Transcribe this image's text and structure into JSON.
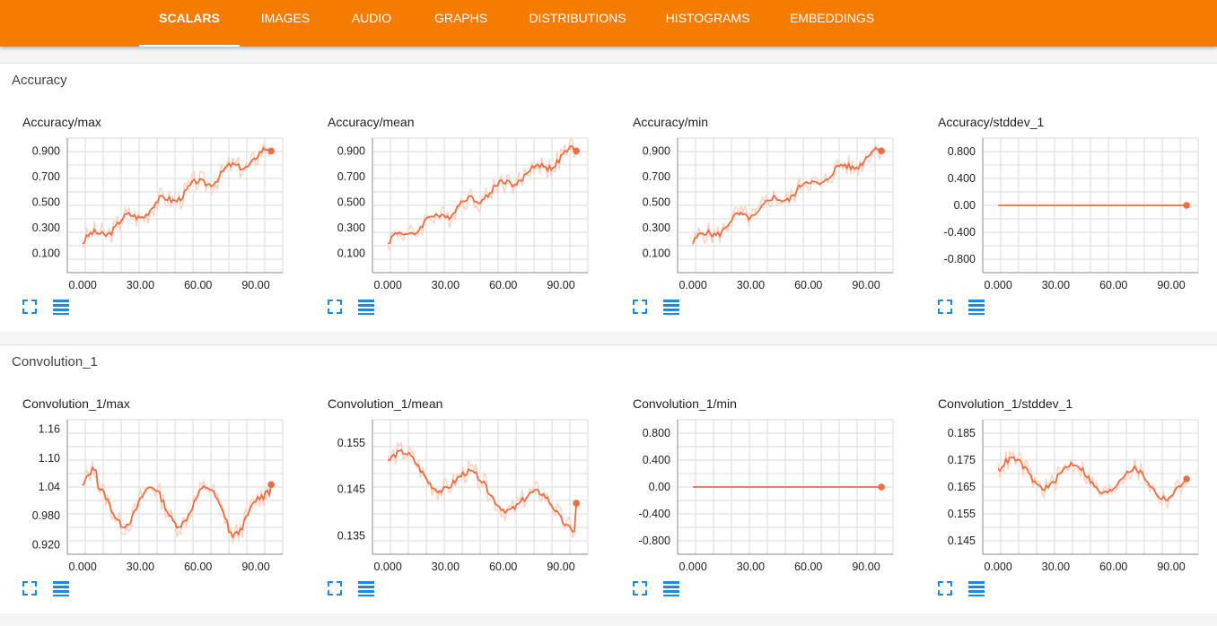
{
  "tabs": [
    {
      "label": "SCALARS",
      "active": true
    },
    {
      "label": "IMAGES",
      "active": false
    },
    {
      "label": "AUDIO",
      "active": false
    },
    {
      "label": "GRAPHS",
      "active": false
    },
    {
      "label": "DISTRIBUTIONS",
      "active": false
    },
    {
      "label": "HISTOGRAMS",
      "active": false
    },
    {
      "label": "EMBEDDINGS",
      "active": false
    }
  ],
  "colors": {
    "accent": "#f57c00",
    "line": "#ef6c3e",
    "line_raw": "#fbd3c4",
    "icon": "#1e88e5",
    "grid": "#d8d8d8"
  },
  "icons": {
    "expand": "fullscreen-icon",
    "data": "list-icon"
  },
  "sections": [
    {
      "name": "Accuracy",
      "charts": [
        {
          "title": "Accuracy/max",
          "yticks": [
            "0.900",
            "0.700",
            "0.500",
            "0.300",
            "0.100"
          ],
          "yvals": [
            0.9,
            0.7,
            0.5,
            0.3,
            0.1
          ],
          "ylim": [
            -0.05,
            1.0
          ],
          "xticks": [
            "0.000",
            "30.00",
            "60.00",
            "90.00"
          ],
          "xvals": [
            0,
            30,
            60,
            90
          ],
          "xlim": [
            -8,
            104
          ],
          "pattern": "rise",
          "start": 0.18,
          "end": 0.9
        },
        {
          "title": "Accuracy/mean",
          "yticks": [
            "0.900",
            "0.700",
            "0.500",
            "0.300",
            "0.100"
          ],
          "yvals": [
            0.9,
            0.7,
            0.5,
            0.3,
            0.1
          ],
          "ylim": [
            -0.05,
            1.0
          ],
          "xticks": [
            "0.000",
            "30.00",
            "60.00",
            "90.00"
          ],
          "xvals": [
            0,
            30,
            60,
            90
          ],
          "xlim": [
            -8,
            104
          ],
          "pattern": "rise",
          "start": 0.18,
          "end": 0.9
        },
        {
          "title": "Accuracy/min",
          "yticks": [
            "0.900",
            "0.700",
            "0.500",
            "0.300",
            "0.100"
          ],
          "yvals": [
            0.9,
            0.7,
            0.5,
            0.3,
            0.1
          ],
          "ylim": [
            -0.05,
            1.0
          ],
          "xticks": [
            "0.000",
            "30.00",
            "60.00",
            "90.00"
          ],
          "xvals": [
            0,
            30,
            60,
            90
          ],
          "xlim": [
            -8,
            104
          ],
          "pattern": "rise",
          "start": 0.18,
          "end": 0.9
        },
        {
          "title": "Accuracy/stddev_1",
          "yticks": [
            "0.800",
            "0.400",
            "0.00",
            "-0.400",
            "-0.800"
          ],
          "yvals": [
            0.8,
            0.4,
            0,
            -0.4,
            -0.8
          ],
          "ylim": [
            -1.0,
            1.0
          ],
          "xticks": [
            "0.000",
            "30.00",
            "60.00",
            "90.00"
          ],
          "xvals": [
            0,
            30,
            60,
            90
          ],
          "xlim": [
            -8,
            104
          ],
          "pattern": "flat",
          "start": 0,
          "end": 0
        }
      ]
    },
    {
      "name": "Convolution_1",
      "charts": [
        {
          "title": "Convolution_1/max",
          "yticks": [
            "1.16",
            "1.10",
            "1.04",
            "0.980",
            "0.920"
          ],
          "yvals": [
            1.16,
            1.1,
            1.04,
            0.98,
            0.92
          ],
          "ylim": [
            0.9,
            1.18
          ],
          "xticks": [
            "0.000",
            "30.00",
            "60.00",
            "90.00"
          ],
          "xvals": [
            0,
            30,
            60,
            90
          ],
          "xlim": [
            -8,
            104
          ],
          "pattern": "conv_max",
          "start": 1.02,
          "end": 1.045
        },
        {
          "title": "Convolution_1/mean",
          "yticks": [
            "0.155",
            "0.145",
            "0.135"
          ],
          "yvals": [
            0.155,
            0.145,
            0.135
          ],
          "ylim": [
            0.131,
            0.16
          ],
          "xticks": [
            "0.000",
            "30.00",
            "60.00",
            "90.00"
          ],
          "xvals": [
            0,
            30,
            60,
            90
          ],
          "xlim": [
            -8,
            104
          ],
          "pattern": "conv_mean",
          "start": 0.149,
          "end": 0.142
        },
        {
          "title": "Convolution_1/min",
          "yticks": [
            "0.800",
            "0.400",
            "0.00",
            "-0.400",
            "-0.800"
          ],
          "yvals": [
            0.8,
            0.4,
            0,
            -0.4,
            -0.8
          ],
          "ylim": [
            -1.0,
            1.0
          ],
          "xticks": [
            "0.000",
            "30.00",
            "60.00",
            "90.00"
          ],
          "xvals": [
            0,
            30,
            60,
            90
          ],
          "xlim": [
            -8,
            104
          ],
          "pattern": "flat",
          "start": 0,
          "end": 0
        },
        {
          "title": "Convolution_1/stddev_1",
          "yticks": [
            "0.185",
            "0.175",
            "0.165",
            "0.155",
            "0.145"
          ],
          "yvals": [
            0.185,
            0.175,
            0.165,
            0.155,
            0.145
          ],
          "ylim": [
            0.14,
            0.19
          ],
          "xticks": [
            "0.000",
            "30.00",
            "60.00",
            "90.00"
          ],
          "xvals": [
            0,
            30,
            60,
            90
          ],
          "xlim": [
            -8,
            104
          ],
          "pattern": "conv_std",
          "start": 0.17,
          "end": 0.168
        }
      ]
    }
  ]
}
